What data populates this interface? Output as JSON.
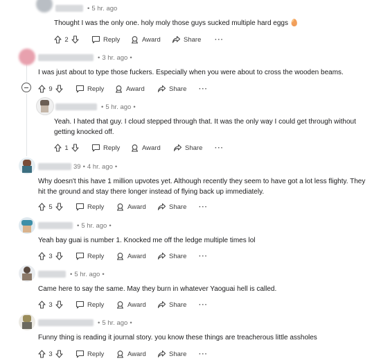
{
  "labels": {
    "reply": "Reply",
    "award": "Award",
    "share": "Share",
    "more": "···"
  },
  "comments": [
    {
      "time": "5 hr. ago",
      "text": "Thought I was the only one. holy moly those guys sucked multiple hard eggs 🥚",
      "votes": "2"
    },
    {
      "time": "3 hr. ago",
      "text": "I was just about to type those fuckers. Especially when you were about to cross the wooden beams.",
      "votes": "9"
    },
    {
      "time": "5 hr. ago",
      "text": "Yeah. I hated that guy. I cloud stepped through that. It was the only way I could get through without getting knocked off.",
      "votes": "1"
    },
    {
      "username_fragment": "39",
      "time": "4 hr. ago",
      "text": "Why doesn't this have 1 million upvotes yet. Although recently they seem to have got a lot less flighty. They hit the ground and stay there longer instead of flying back up immediately.",
      "votes": "5"
    },
    {
      "time": "5 hr. ago",
      "text": "Yeah bay guai is number 1. Knocked me off the ledge multiple times lol",
      "votes": "3"
    },
    {
      "time": "5 hr. ago",
      "text": "Came here to say the same. May they burn in whatever Yaoguai hell is called.",
      "votes": "3"
    },
    {
      "time": "5 hr. ago",
      "text": "Funny thing is reading it journal story. you know these things are treacherous little assholes",
      "votes": "3"
    }
  ]
}
